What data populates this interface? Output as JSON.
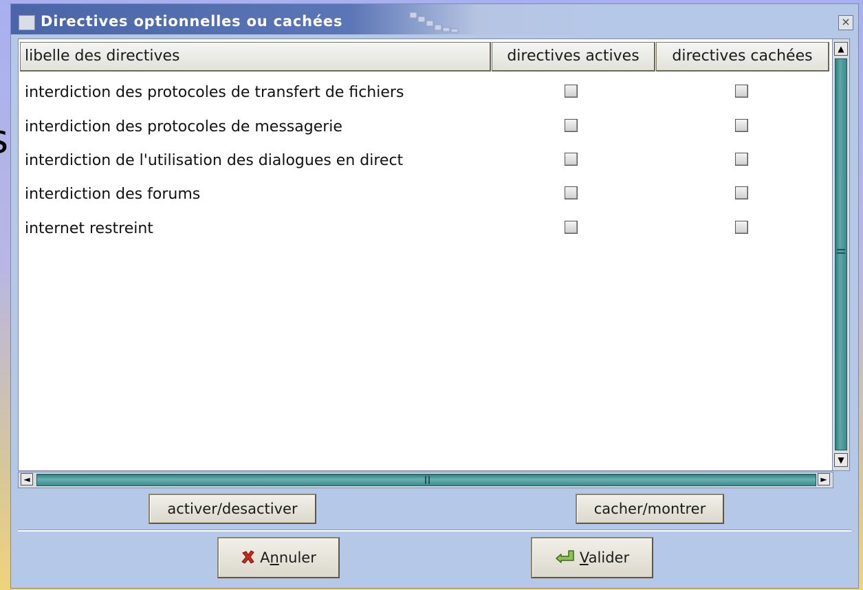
{
  "background": {
    "peek_text": "s"
  },
  "window": {
    "title": "Directives optionnelles ou cachées",
    "close_symbol": "×"
  },
  "table": {
    "columns": [
      "libelle des directives",
      "directives actives",
      "directives cachées"
    ],
    "rows": [
      {
        "label": "interdiction des protocoles de transfert de fichiers",
        "active": false,
        "hidden": false
      },
      {
        "label": "interdiction des protocoles de messagerie",
        "active": false,
        "hidden": false
      },
      {
        "label": "interdiction de l'utilisation des dialogues en direct",
        "active": false,
        "hidden": false
      },
      {
        "label": "interdiction des forums",
        "active": false,
        "hidden": false
      },
      {
        "label": "internet restreint",
        "active": false,
        "hidden": false
      }
    ]
  },
  "scrollbar_arrows": {
    "up": "▲",
    "down": "▼",
    "left": "◄",
    "right": "►"
  },
  "actions": {
    "toggle_active_label": "activer/desactiver",
    "toggle_hidden_label": "cacher/montrer"
  },
  "dialog_buttons": {
    "cancel": {
      "prefix": "A",
      "mnemonic": "n",
      "suffix": "nuler"
    },
    "ok": {
      "prefix": "",
      "mnemonic": "V",
      "suffix": "alider"
    }
  },
  "icons": {
    "cancel": "red-x-icon",
    "ok": "green-check-arrow-icon",
    "close": "close-icon"
  },
  "colors": {
    "window_bg": "#b6c8e8",
    "title_gradient_start": "#4a66a8",
    "scroll_thumb": "#3a8c8d",
    "cancel_icon": "#cc2a1c",
    "ok_icon": "#6aa83a"
  }
}
